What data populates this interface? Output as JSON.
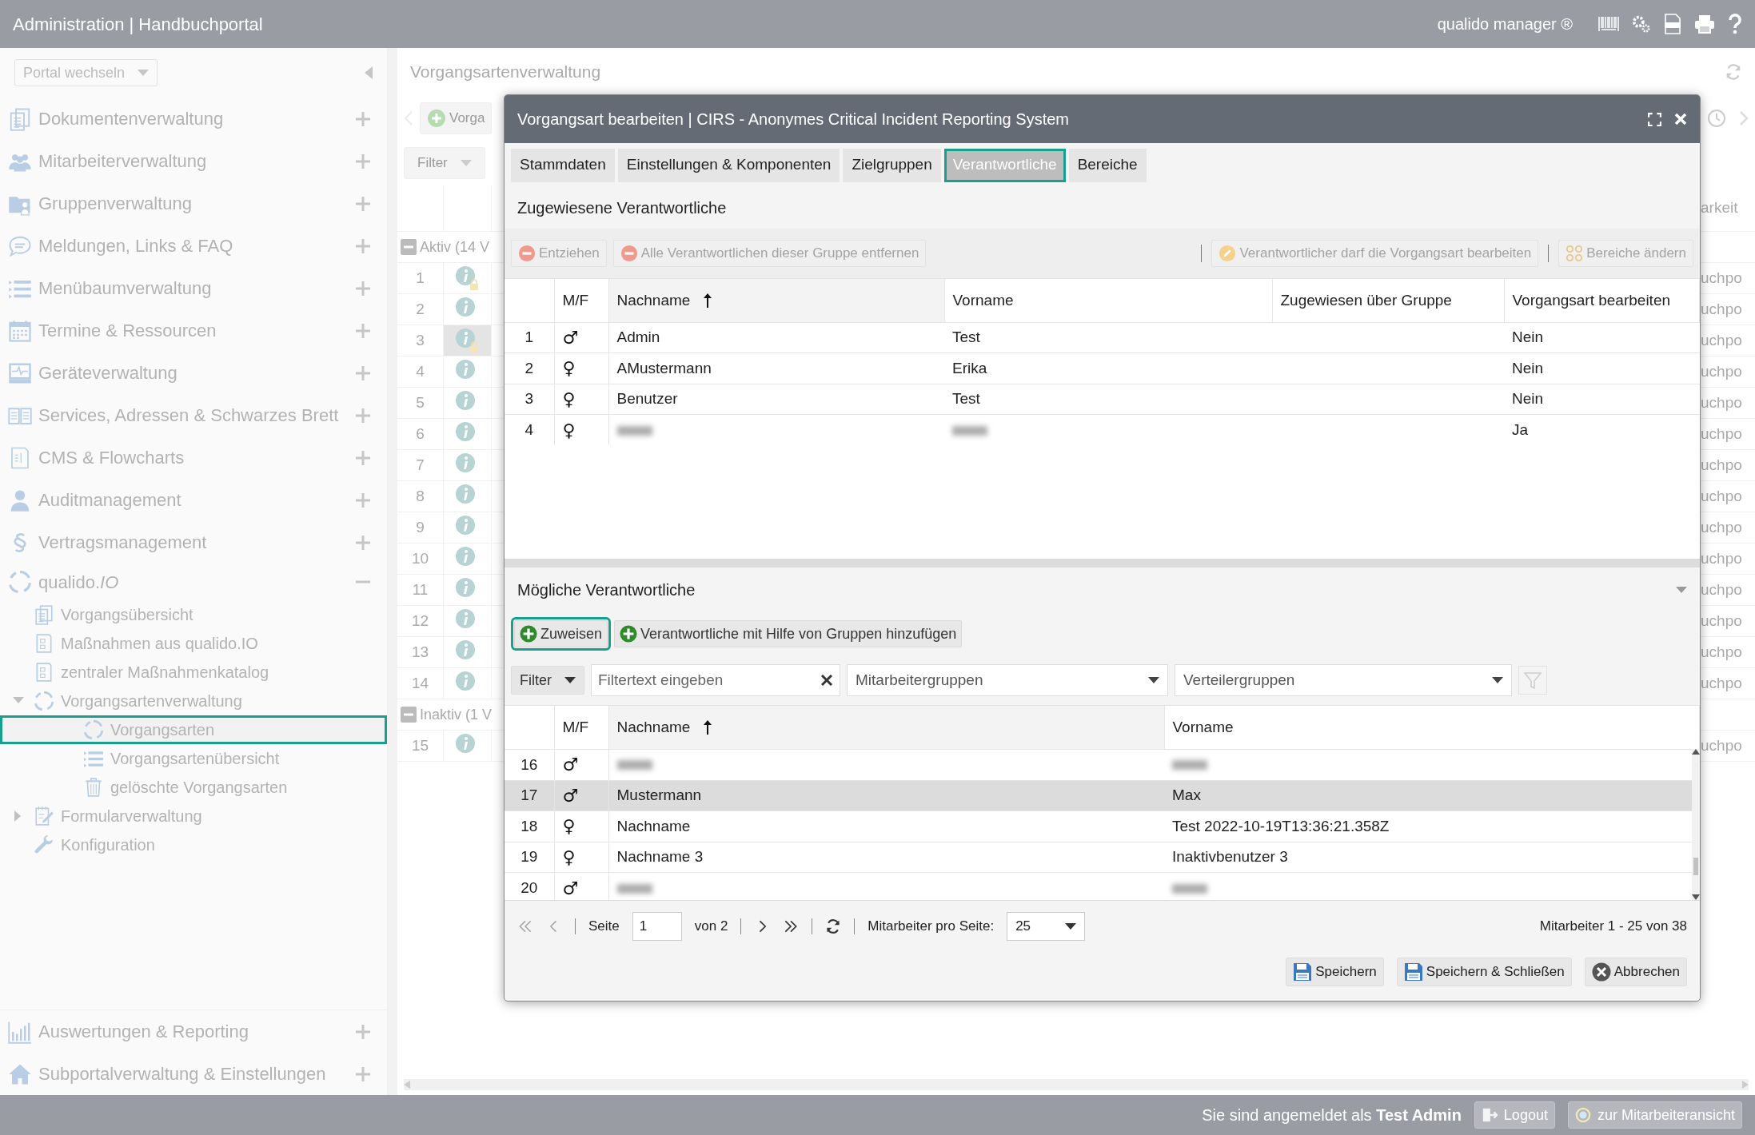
{
  "app_bar": {
    "title": "Administration | Handbuchportal",
    "product": "qualido manager ®"
  },
  "sidebar": {
    "portal_select": "Portal wechseln",
    "items": [
      {
        "label": "Dokumentenverwaltung",
        "expanded": false
      },
      {
        "label": "Mitarbeiterverwaltung",
        "expanded": false
      },
      {
        "label": "Gruppenverwaltung",
        "expanded": false
      },
      {
        "label": "Meldungen, Links & FAQ",
        "expanded": false
      },
      {
        "label": "Menübaumverwaltung",
        "expanded": false
      },
      {
        "label": "Termine & Ressourcen",
        "expanded": false
      },
      {
        "label": "Geräteverwaltung",
        "expanded": false
      },
      {
        "label": "Services, Adressen & Schwarzes Brett",
        "expanded": false
      },
      {
        "label": "CMS & Flowcharts",
        "expanded": false
      },
      {
        "label": "Auditmanagement",
        "expanded": false
      },
      {
        "label": "Vertragsmanagement",
        "expanded": false
      },
      {
        "label": "qualido.*IO*",
        "expanded": true,
        "children": [
          {
            "label": "Vorgangsübersicht",
            "selected": false
          },
          {
            "label": "Maßnahmen aus qualido.IO",
            "selected": false
          },
          {
            "label": "zentraler Maßnahmenkatalog",
            "selected": false
          },
          {
            "label": "Vorgangsartenverwaltung",
            "selected": false,
            "expanded": true,
            "children": [
              {
                "label": "Vorgangsarten",
                "selected": true
              },
              {
                "label": "Vorgangsartenübersicht",
                "selected": false
              },
              {
                "label": "gelöschte Vorgangsarten",
                "selected": false
              }
            ]
          },
          {
            "label": "Formularverwaltung",
            "selected": false,
            "expanded": false
          },
          {
            "label": "Konfiguration",
            "selected": false
          }
        ]
      }
    ],
    "bottom_items": [
      {
        "label": "Auswertungen & Reporting",
        "expanded": false
      },
      {
        "label": "Subportalverwaltung & Einstellungen",
        "expanded": false
      }
    ]
  },
  "page": {
    "title": "Vorgangsartenverwaltung",
    "new_button": "Vorga",
    "filter": "Filter",
    "last_column_header": "arkeit",
    "groups": [
      {
        "label": "Aktiv (14 V",
        "expanded": true,
        "rows": [
          {
            "number": "1",
            "locked": true,
            "selected": false,
            "last_column": "uchpo"
          },
          {
            "number": "2",
            "locked": false,
            "selected": false,
            "last_column": "uchpo"
          },
          {
            "number": "3",
            "locked": true,
            "selected": true,
            "last_column": "uchpo"
          },
          {
            "number": "4",
            "locked": false,
            "selected": false,
            "last_column": "uchpo"
          },
          {
            "number": "5",
            "locked": false,
            "selected": false,
            "last_column": "uchpo"
          },
          {
            "number": "6",
            "locked": false,
            "selected": false,
            "last_column": "uchpo"
          },
          {
            "number": "7",
            "locked": false,
            "selected": false,
            "last_column": "uchpo"
          },
          {
            "number": "8",
            "locked": false,
            "selected": false,
            "last_column": "uchpo"
          },
          {
            "number": "9",
            "locked": false,
            "selected": false,
            "last_column": "uchpo"
          },
          {
            "number": "10",
            "locked": false,
            "selected": false,
            "last_column": "uchpo"
          },
          {
            "number": "11",
            "locked": false,
            "selected": false,
            "last_column": "uchpo"
          },
          {
            "number": "12",
            "locked": false,
            "selected": false,
            "last_column": "uchpo"
          },
          {
            "number": "13",
            "locked": false,
            "selected": false,
            "last_column": "uchpo"
          },
          {
            "number": "14",
            "locked": false,
            "selected": false,
            "last_column": "uchpo"
          }
        ]
      },
      {
        "label": "Inaktiv (1 V",
        "expanded": true,
        "rows": [
          {
            "number": "15",
            "locked": false,
            "selected": false,
            "last_column": "uchpo"
          }
        ]
      }
    ]
  },
  "dialog": {
    "title": "Vorgangsart bearbeiten | CIRS - Anonymes Critical Incident Reporting System",
    "tabs": [
      {
        "label": "Stammdaten",
        "selected": false
      },
      {
        "label": "Einstellungen & Komponenten",
        "selected": false
      },
      {
        "label": "Zielgruppen",
        "selected": false
      },
      {
        "label": "Verantwortliche",
        "selected": true
      },
      {
        "label": "Bereiche",
        "selected": false
      }
    ],
    "assigned": {
      "title": "Zugewiesene Verantwortliche",
      "actions": [
        {
          "label": "Entziehen",
          "kind": "remove",
          "disabled": true
        },
        {
          "label": "Alle Verantwortlichen dieser Gruppe entfernen",
          "kind": "remove",
          "disabled": true
        },
        {
          "label": "Verantwortlicher darf die Vorgangsart bearbeiten",
          "kind": "edit",
          "disabled": true
        },
        {
          "label": "Bereiche ändern",
          "kind": "areas",
          "disabled": true
        }
      ],
      "columns": [
        {
          "label": "M/F",
          "sorted": false
        },
        {
          "label": "Nachname",
          "sorted": true
        },
        {
          "label": "Vorname",
          "sorted": false
        },
        {
          "label": "Zugewiesen über Gruppe",
          "sorted": false
        },
        {
          "label": "Vorgangsart bearbeiten",
          "sorted": false
        }
      ],
      "rows": [
        {
          "number": "1",
          "sex": "♂",
          "last_name": "Admin",
          "first_name": "Test",
          "edit": "Nein"
        },
        {
          "number": "2",
          "sex": "♀",
          "last_name": "AMustermann",
          "first_name": "Erika",
          "edit": "Nein"
        },
        {
          "number": "3",
          "sex": "♀",
          "last_name": "Benutzer",
          "first_name": "Test",
          "edit": "Nein"
        },
        {
          "number": "4",
          "sex": "♀",
          "redacted": true,
          "edit": "Ja"
        }
      ]
    },
    "candidates": {
      "title": "Mögliche Verantwortliche",
      "expanded": true,
      "actions": [
        {
          "label": "Zuweisen",
          "focused": true
        },
        {
          "label": "Verantwortliche mit Hilfe von Gruppen hinzufügen",
          "focused": false
        }
      ],
      "filter": {
        "button": "Filter",
        "placeholder": "Filtertext eingeben",
        "group_select": "Mitarbeitergruppen",
        "distribution_select": "Verteilergruppen"
      },
      "columns": [
        {
          "label": "M/F",
          "sorted": false
        },
        {
          "label": "Nachname",
          "sorted": true
        },
        {
          "label": "Vorname",
          "sorted": false
        }
      ],
      "rows": [
        {
          "number": "16",
          "sex": "♂",
          "redacted": true,
          "selected": false
        },
        {
          "number": "17",
          "sex": "♂",
          "last_name": "Mustermann",
          "first_name": "Max",
          "selected": true
        },
        {
          "number": "18",
          "sex": "♀",
          "last_name": "Nachname",
          "first_name": "Test 2022-10-19T13:36:21.358Z",
          "selected": false
        },
        {
          "number": "19",
          "sex": "♀",
          "last_name": "Nachname 3",
          "first_name": "Inaktivbenutzer 3",
          "selected": false
        },
        {
          "number": "20",
          "sex": "♂",
          "redacted": true,
          "selected": false
        }
      ],
      "pager": {
        "page_label": "Seite",
        "page": "1",
        "of": "von 2",
        "per_page_label": "Mitarbeiter pro Seite:",
        "per_page": "25",
        "summary": "Mitarbeiter 1 - 25 von 38"
      }
    },
    "buttons": [
      {
        "label": "Speichern",
        "kind": "save"
      },
      {
        "label": "Speichern & Schließen",
        "kind": "save"
      },
      {
        "label": "Abbrechen",
        "kind": "cancel"
      }
    ]
  },
  "status_bar": {
    "login_text": "Sie sind angemeldet als **Test Admin**",
    "buttons": [
      {
        "label": "Logout",
        "kind": "logout"
      },
      {
        "label": "zur Mitarbeiteransicht",
        "kind": "view"
      }
    ]
  }
}
